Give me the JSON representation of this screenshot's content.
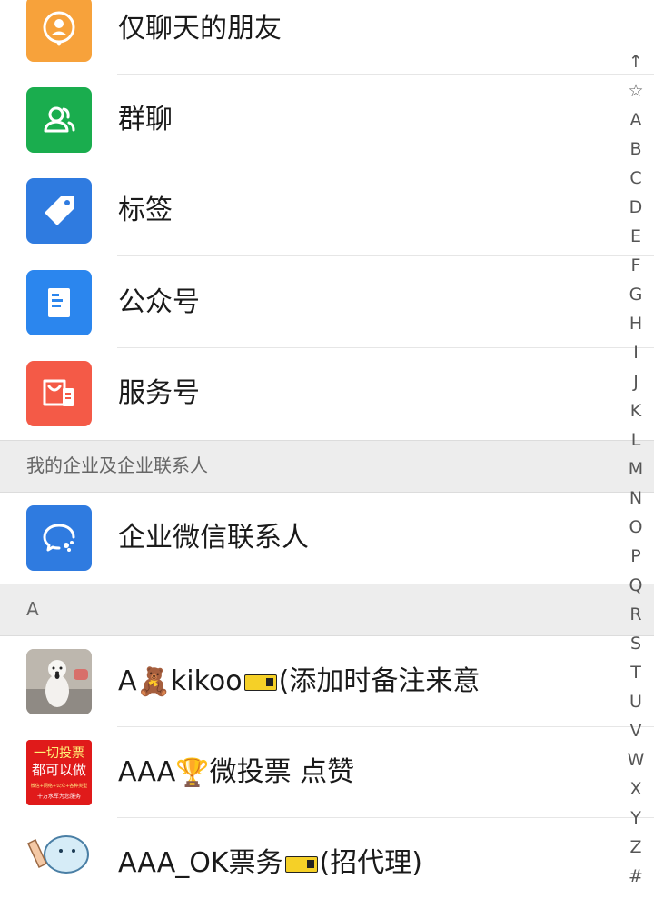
{
  "contacts": {
    "top_items": [
      {
        "label": "仅聊天的朋友",
        "icon": "person-chat-icon",
        "color": "#F7A23B"
      },
      {
        "label": "群聊",
        "icon": "group-icon",
        "color": "#1AAD4E"
      },
      {
        "label": "标签",
        "icon": "tag-icon",
        "color": "#2F7BE0"
      },
      {
        "label": "公众号",
        "icon": "official-account-icon",
        "color": "#2B86EE"
      },
      {
        "label": "服务号",
        "icon": "service-account-icon",
        "color": "#F45A47"
      }
    ],
    "enterprise_section": "我的企业及企业联系人",
    "enterprise_item": {
      "label": "企业微信联系人",
      "icon": "wecom-chat-icon",
      "color": "#2F7BE0"
    },
    "section_a": "A",
    "a_items": [
      {
        "prefix": "A",
        "emoji": "🧸",
        "middle": "kikoo",
        "suffix": "(添加时备注来意"
      },
      {
        "prefix": "AAA",
        "emoji": "🏆",
        "middle": "",
        "suffix": "微投票 点赞"
      },
      {
        "prefix": "AAA_OK票务",
        "emoji": "",
        "middle": "",
        "suffix": "(招代理)"
      }
    ],
    "avatar_2_text_top": "一切投票",
    "avatar_2_text_bottom": "都可以做",
    "avatar_2_text_small": "微信+网络+公众+各种类型",
    "avatar_2_text_small2": "十万水军为您服务"
  },
  "index_bar": [
    "↑",
    "☆",
    "A",
    "B",
    "C",
    "D",
    "E",
    "F",
    "G",
    "H",
    "I",
    "J",
    "K",
    "L",
    "M",
    "N",
    "O",
    "P",
    "Q",
    "R",
    "S",
    "T",
    "U",
    "V",
    "W",
    "X",
    "Y",
    "Z",
    "#"
  ]
}
